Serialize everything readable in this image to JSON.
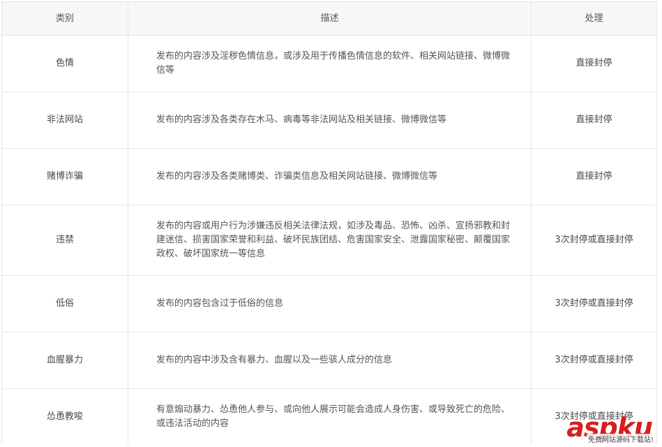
{
  "table": {
    "headers": [
      "类别",
      "描述",
      "处理"
    ],
    "rows": [
      {
        "category": "色情",
        "description": "发布的内容涉及淫秽色情信息，或涉及用于传播色情信息的软件、相关网站链接、微博微信等",
        "action": "直接封停"
      },
      {
        "category": "非法网站",
        "description": "发布的内容涉及各类存在木马、病毒等非法网站及相关链接、微博微信等",
        "action": "直接封停"
      },
      {
        "category": "赌博诈骗",
        "description": "发布的内容涉及各类赌博类、诈骗类信息及相关网站链接、微博微信等",
        "action": "直接封停"
      },
      {
        "category": "违禁",
        "description": "发布的内容或用户行为涉嫌违反相关法律法规，如涉及毒品、恐怖、凶杀、宣扬邪教和封建迷信、损害国家荣誉和利益、破坏民族团结、危害国家安全、泄露国家秘密、颠覆国家政权、破坏国家统一等信息",
        "action": "3次封停或直接封停"
      },
      {
        "category": "低俗",
        "description": "发布的内容包含过于低俗的信息",
        "action": "3次封停或直接封停"
      },
      {
        "category": "血腥暴力",
        "description": "发布的内容中涉及含有暴力、血腥以及一些骇人成分的信息",
        "action": "3次封停或直接封停"
      },
      {
        "category": "怂恿教唆",
        "description": "有意煽动暴力、怂恿他人参与、或向他人展示可能会造成人身伤害、或导致死亡的危险、或违法活动的内容",
        "action": "3次封停或直接封停"
      }
    ]
  },
  "watermark": {
    "brand": "aspku",
    "tagline": "免费网站源码下载站!"
  },
  "colors": {
    "border": "#e6e6e6",
    "header_bg": "#f5f7f9",
    "text": "#4a4a4a",
    "watermark_red": "#d42020"
  }
}
